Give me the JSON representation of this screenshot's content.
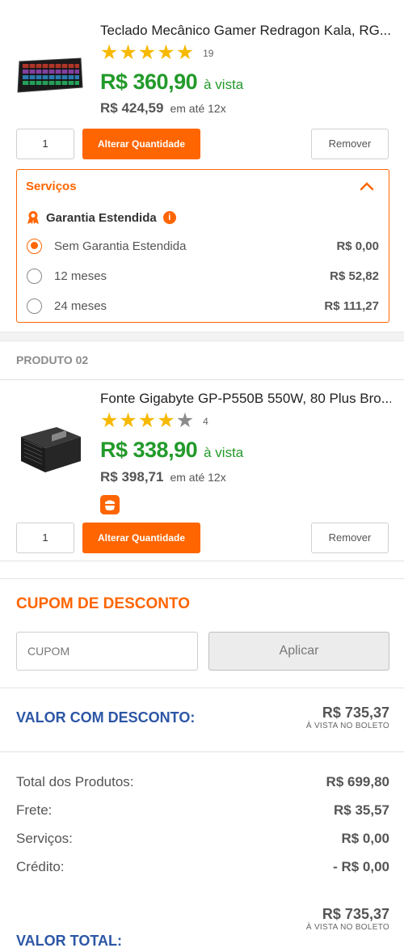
{
  "products": [
    {
      "title": "Teclado Mecânico Gamer Redragon Kala, RG...",
      "rating_stars": 5,
      "rating_count": "19",
      "price": "R$ 360,90",
      "price_label": "à vista",
      "old_price": "R$ 424,59",
      "installments": "em até 12x",
      "quantity": "1",
      "update_label": "Alterar Quantidade",
      "remove_label": "Remover"
    },
    {
      "section_label": "PRODUTO 02",
      "title": "Fonte Gigabyte GP-P550B 550W, 80 Plus Bro...",
      "rating_stars": 4,
      "rating_count": "4",
      "price": "R$ 338,90",
      "price_label": "à vista",
      "old_price": "R$ 398,71",
      "installments": "em até 12x",
      "quantity": "1",
      "update_label": "Alterar Quantidade",
      "remove_label": "Remover"
    }
  ],
  "services": {
    "title": "Serviços",
    "warranty_label": "Garantia Estendida",
    "info_icon": "i",
    "options": [
      {
        "label": "Sem Garantia Estendida",
        "price": "R$ 0,00",
        "selected": true
      },
      {
        "label": "12 meses",
        "price": "R$ 52,82",
        "selected": false
      },
      {
        "label": "24 meses",
        "price": "R$ 111,27",
        "selected": false
      }
    ]
  },
  "coupon": {
    "title": "CUPOM DE DESCONTO",
    "placeholder": "CUPOM",
    "apply_label": "Aplicar"
  },
  "discount": {
    "label": "VALOR COM DESCONTO:",
    "value": "R$ 735,37",
    "note": "À VISTA NO BOLETO"
  },
  "summary": [
    {
      "label": "Total dos Produtos:",
      "value": "R$ 699,80"
    },
    {
      "label": "Frete:",
      "value": "R$ 35,57"
    },
    {
      "label": "Serviços:",
      "value": "R$ 0,00"
    },
    {
      "label": "Crédito:",
      "value": "- R$ 0,00"
    }
  ],
  "total": {
    "label": "VALOR TOTAL:",
    "value": "R$ 735,37",
    "note": "À VISTA NO BOLETO"
  },
  "colors": {
    "accent": "#ff6500",
    "price_green": "#229a2a",
    "label_blue": "#2c56a6",
    "star": "#f6b900"
  },
  "icons": {
    "keyboard": "keyboard-product-image",
    "psu": "power-supply-product-image",
    "award": "award-ribbon-icon",
    "chevron": "chevron-up-icon",
    "badge": "store-badge-icon"
  }
}
